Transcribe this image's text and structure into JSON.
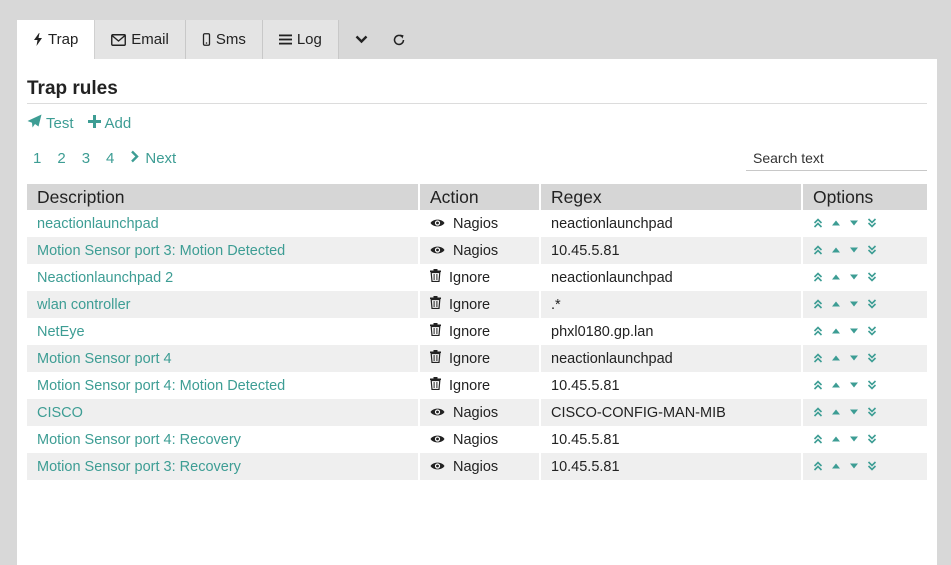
{
  "tabs": [
    {
      "label": "Trap",
      "icon": "bolt-icon"
    },
    {
      "label": "Email",
      "icon": "envelope-icon"
    },
    {
      "label": "Sms",
      "icon": "mobile-icon"
    },
    {
      "label": "Log",
      "icon": "list-icon"
    }
  ],
  "toolbar_icons": {
    "expand": "chevron-down-icon",
    "refresh": "refresh-icon"
  },
  "page": {
    "title": "Trap rules"
  },
  "actions": {
    "test_label": "Test",
    "add_label": "Add"
  },
  "pagination": {
    "pages": [
      "1",
      "2",
      "3",
      "4"
    ],
    "next_label": "Next"
  },
  "search": {
    "placeholder": "Search text",
    "value": ""
  },
  "table": {
    "headers": [
      "Description",
      "Action",
      "Regex",
      "Options"
    ],
    "rows": [
      {
        "description": "neactionlaunchpad",
        "action": "Nagios",
        "action_icon": "eye-icon",
        "regex": "neactionlaunchpad"
      },
      {
        "description": "Motion Sensor port 3: Motion Detected",
        "action": "Nagios",
        "action_icon": "eye-icon",
        "regex": "10.45.5.81"
      },
      {
        "description": "Neactionlaunchpad 2",
        "action": "Ignore",
        "action_icon": "trash-icon",
        "regex": "neactionlaunchpad"
      },
      {
        "description": "wlan controller",
        "action": "Ignore",
        "action_icon": "trash-icon",
        "regex": ".*"
      },
      {
        "description": "NetEye",
        "action": "Ignore",
        "action_icon": "trash-icon",
        "regex": "phxl0180.gp.lan"
      },
      {
        "description": "Motion Sensor port 4",
        "action": "Ignore",
        "action_icon": "trash-icon",
        "regex": "neactionlaunchpad"
      },
      {
        "description": "Motion Sensor port 4: Motion Detected",
        "action": "Ignore",
        "action_icon": "trash-icon",
        "regex": "10.45.5.81"
      },
      {
        "description": "CISCO",
        "action": "Nagios",
        "action_icon": "eye-icon",
        "regex": "CISCO-CONFIG-MAN-MIB"
      },
      {
        "description": "Motion Sensor port 4: Recovery",
        "action": "Nagios",
        "action_icon": "eye-icon",
        "regex": "10.45.5.81"
      },
      {
        "description": "Motion Sensor port 3: Recovery",
        "action": "Nagios",
        "action_icon": "eye-icon",
        "regex": "10.45.5.81"
      }
    ],
    "option_icons": [
      "move-top-icon",
      "move-up-icon",
      "move-down-icon",
      "move-bottom-icon"
    ]
  },
  "colors": {
    "accent": "#3d9d94",
    "header_bg": "#d6d6d6",
    "alt_row": "#efefef",
    "page_bg": "#d8d8d8"
  }
}
